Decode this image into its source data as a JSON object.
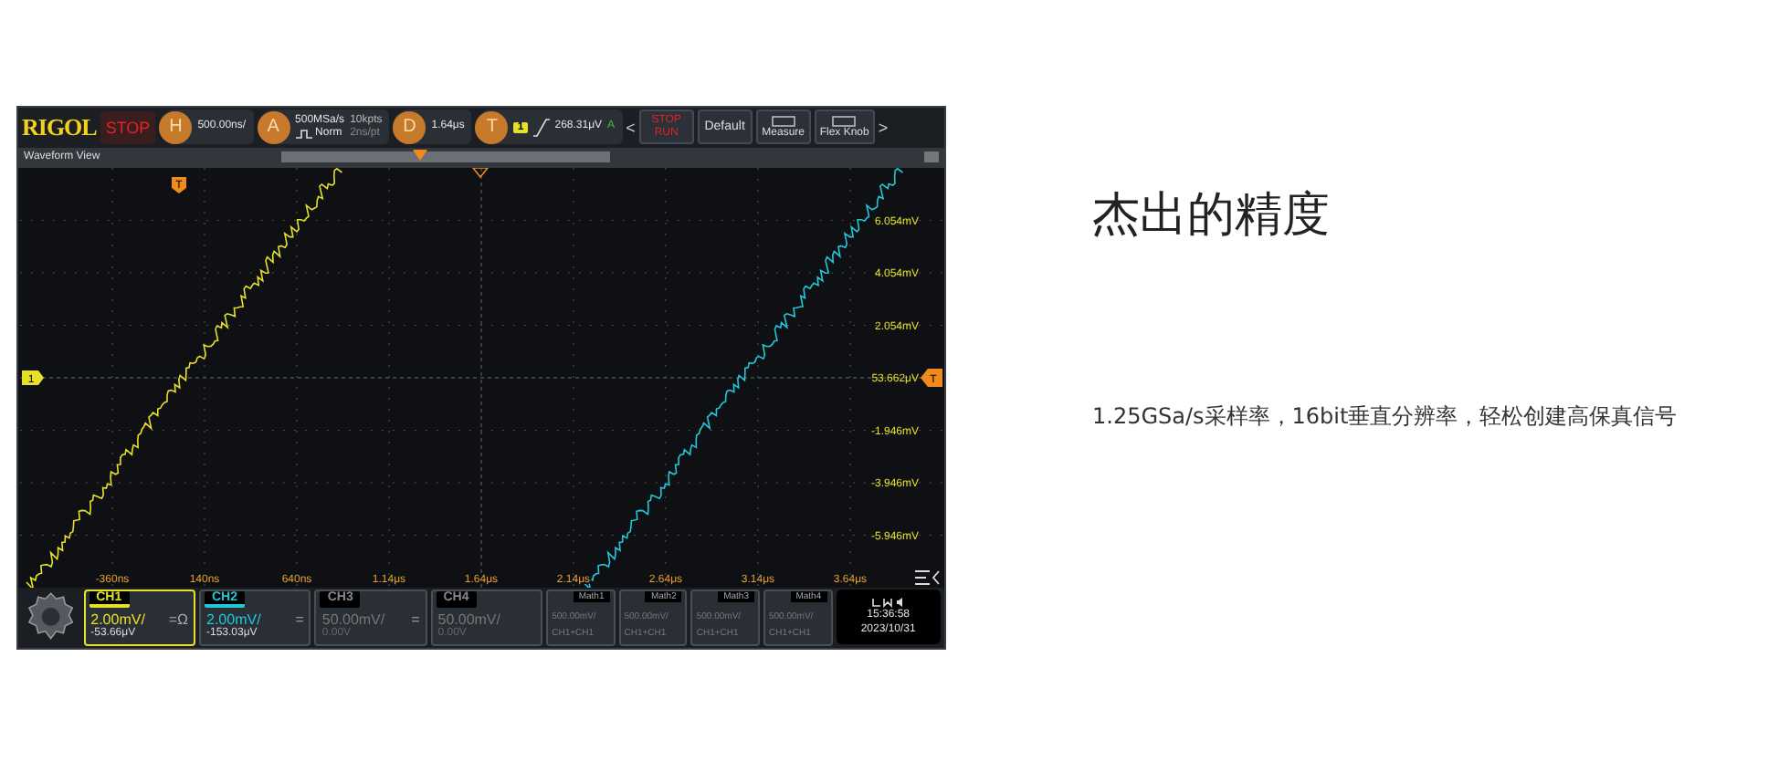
{
  "scope": {
    "top_bar": {
      "logo": "RIGOL",
      "run_state": "STOP",
      "horizontal": {
        "badge": "H",
        "value": "500.00ns/"
      },
      "acquire": {
        "badge": "A",
        "rate": "500MSa/s",
        "mode": "Norm",
        "depth": "10kpts",
        "resolution": "2ns/pt"
      },
      "delay": {
        "badge": "D",
        "value": "1.64μs"
      },
      "trigger": {
        "badge": "T",
        "source": "1",
        "level": "268.31μV",
        "mode": "A"
      },
      "nav_left": "<",
      "buttons": [
        {
          "kind": "run",
          "lines": [
            "STOP",
            "RUN"
          ]
        },
        {
          "kind": "text",
          "label": "Default"
        },
        {
          "kind": "icon",
          "label": "Measure"
        },
        {
          "kind": "icon",
          "label": "Flex Knob"
        }
      ],
      "nav_right": ">"
    },
    "waveform_view": {
      "title": "Waveform View"
    },
    "plot": {
      "trigger_marker": "T",
      "channel_marker": "1",
      "level_marker": "T",
      "x_labels": [
        "-360ns",
        "140ns",
        "640ns",
        "1.14μs",
        "1.64μs",
        "2.14μs",
        "2.64μs",
        "3.14μs",
        "3.64μs"
      ],
      "y_labels": [
        "6.054mV",
        "4.054mV",
        "2.054mV",
        "53.662μV",
        "-1.946mV",
        "-3.946mV",
        "-5.946mV"
      ]
    },
    "channels": [
      {
        "name": "CH1",
        "scale": "2.00mV/",
        "coupling": "=",
        "impedance": "Ω",
        "offset": "-53.66μV",
        "on": true,
        "selected": true,
        "color": "#e6e02a"
      },
      {
        "name": "CH2",
        "scale": "2.00mV/",
        "coupling": "=",
        "offset": "-153.03μV",
        "on": true,
        "selected": false,
        "color": "#22c8d8"
      },
      {
        "name": "CH3",
        "scale": "50.00mV/",
        "coupling": "=",
        "offset": "0.00V",
        "on": false,
        "selected": false
      },
      {
        "name": "CH4",
        "scale": "50.00mV/",
        "offset": "0.00V",
        "on": false,
        "selected": false
      }
    ],
    "math": [
      {
        "name": "Math1",
        "scale": "500.00mV/",
        "expression": "CH1+CH1"
      },
      {
        "name": "Math2",
        "scale": "500.00mV/",
        "expression": "CH1+CH1"
      },
      {
        "name": "Math3",
        "scale": "500.00mV/",
        "expression": "CH1+CH1"
      },
      {
        "name": "Math4",
        "scale": "500.00mV/",
        "expression": "CH1+CH1"
      }
    ],
    "status": {
      "time": "15:36:58",
      "date": "2023/10/31"
    }
  },
  "heading": "杰出的精度",
  "description": "1.25GSa/s采样率，16bit垂直分辨率，轻松创建高保真信号"
}
